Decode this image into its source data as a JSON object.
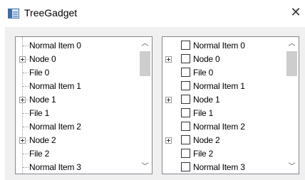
{
  "window": {
    "title": "TreeGadget",
    "close_glyph": "✕"
  },
  "tree_left": {
    "items": [
      {
        "label": "Normal Item 0",
        "type": "normal"
      },
      {
        "label": "Node 0",
        "type": "node"
      },
      {
        "label": "File 0",
        "type": "file"
      },
      {
        "label": "Normal Item 1",
        "type": "normal"
      },
      {
        "label": "Node 1",
        "type": "node"
      },
      {
        "label": "File 1",
        "type": "file"
      },
      {
        "label": "Normal Item 2",
        "type": "normal"
      },
      {
        "label": "Node 2",
        "type": "node"
      },
      {
        "label": "File 2",
        "type": "file"
      },
      {
        "label": "Normal Item 3",
        "type": "normal"
      }
    ]
  },
  "tree_right": {
    "items": [
      {
        "label": "Normal Item 0",
        "type": "normal"
      },
      {
        "label": "Node 0",
        "type": "node"
      },
      {
        "label": "File 0",
        "type": "file"
      },
      {
        "label": "Normal Item 1",
        "type": "normal"
      },
      {
        "label": "Node 1",
        "type": "node"
      },
      {
        "label": "File 1",
        "type": "file"
      },
      {
        "label": "Normal Item 2",
        "type": "normal"
      },
      {
        "label": "Node 2",
        "type": "node"
      },
      {
        "label": "File 2",
        "type": "file"
      },
      {
        "label": "Normal Item 3",
        "type": "normal"
      }
    ]
  },
  "scrollbar": {
    "up_glyph": "︿",
    "down_glyph": "﹀"
  },
  "colors": {
    "tree_border": "#828790",
    "client_bg": "#f0f0f0",
    "scroll_thumb": "#cdcdcd"
  }
}
